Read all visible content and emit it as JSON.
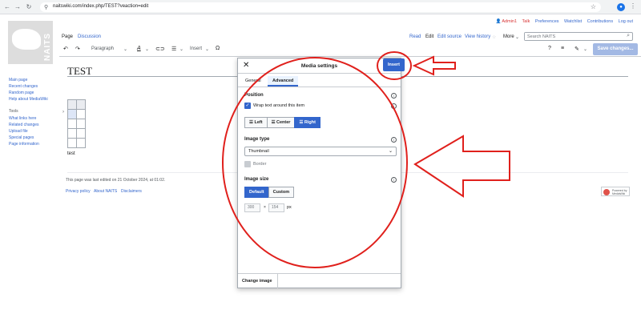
{
  "browser": {
    "url": "naitswiki.com/index.php/TEST?veaction=edit"
  },
  "personal_tools": {
    "username": "Admin1",
    "items": [
      "Talk",
      "Preferences",
      "Watchlist",
      "Contributions",
      "Log out"
    ]
  },
  "logo": {
    "text": "NAITS"
  },
  "tabs": {
    "page": "Page",
    "discussion": "Discussion",
    "read": "Read",
    "edit": "Edit",
    "edit_source": "Edit source",
    "view_history": "View history",
    "more": "More"
  },
  "search": {
    "placeholder": "Search NAITS"
  },
  "toolbar": {
    "format": "Paragraph",
    "insert": "Insert",
    "save": "Save changes..."
  },
  "sidebar": {
    "nav": [
      "Main page",
      "Recent changes",
      "Random page",
      "Help about MediaWiki"
    ],
    "tools_heading": "Tools",
    "tools": [
      "What links here",
      "Related changes",
      "Upload file",
      "Special pages",
      "Page information"
    ]
  },
  "content": {
    "title": "TEST",
    "body_text": "test",
    "last_edited": "This page was last edited on 21 October 2024, at 01:02.",
    "footer_links": [
      "Privacy policy",
      "About NAITS",
      "Disclaimers"
    ],
    "powered_by": "Powered by MediaWiki"
  },
  "dialog": {
    "title": "Media settings",
    "tabs": [
      "General",
      "Advanced"
    ],
    "active_tab": "Advanced",
    "position_label": "Position",
    "wrap_label": "Wrap text around this item",
    "wrap_checked": true,
    "position_options": [
      "Left",
      "Center",
      "Right"
    ],
    "position_selected": "Right",
    "image_type_label": "Image type",
    "image_type_value": "Thumbnail",
    "border_label": "Border",
    "image_size_label": "Image size",
    "size_options": [
      "Default",
      "Custom"
    ],
    "size_selected": "Default",
    "width": "300",
    "height": "154",
    "times": "×",
    "unit": "px",
    "change_image": "Change image",
    "insert": "Insert"
  },
  "colors": {
    "accent": "#3366cc",
    "annotation": "#e0201c",
    "save_disabled": "#a3b9e4"
  }
}
